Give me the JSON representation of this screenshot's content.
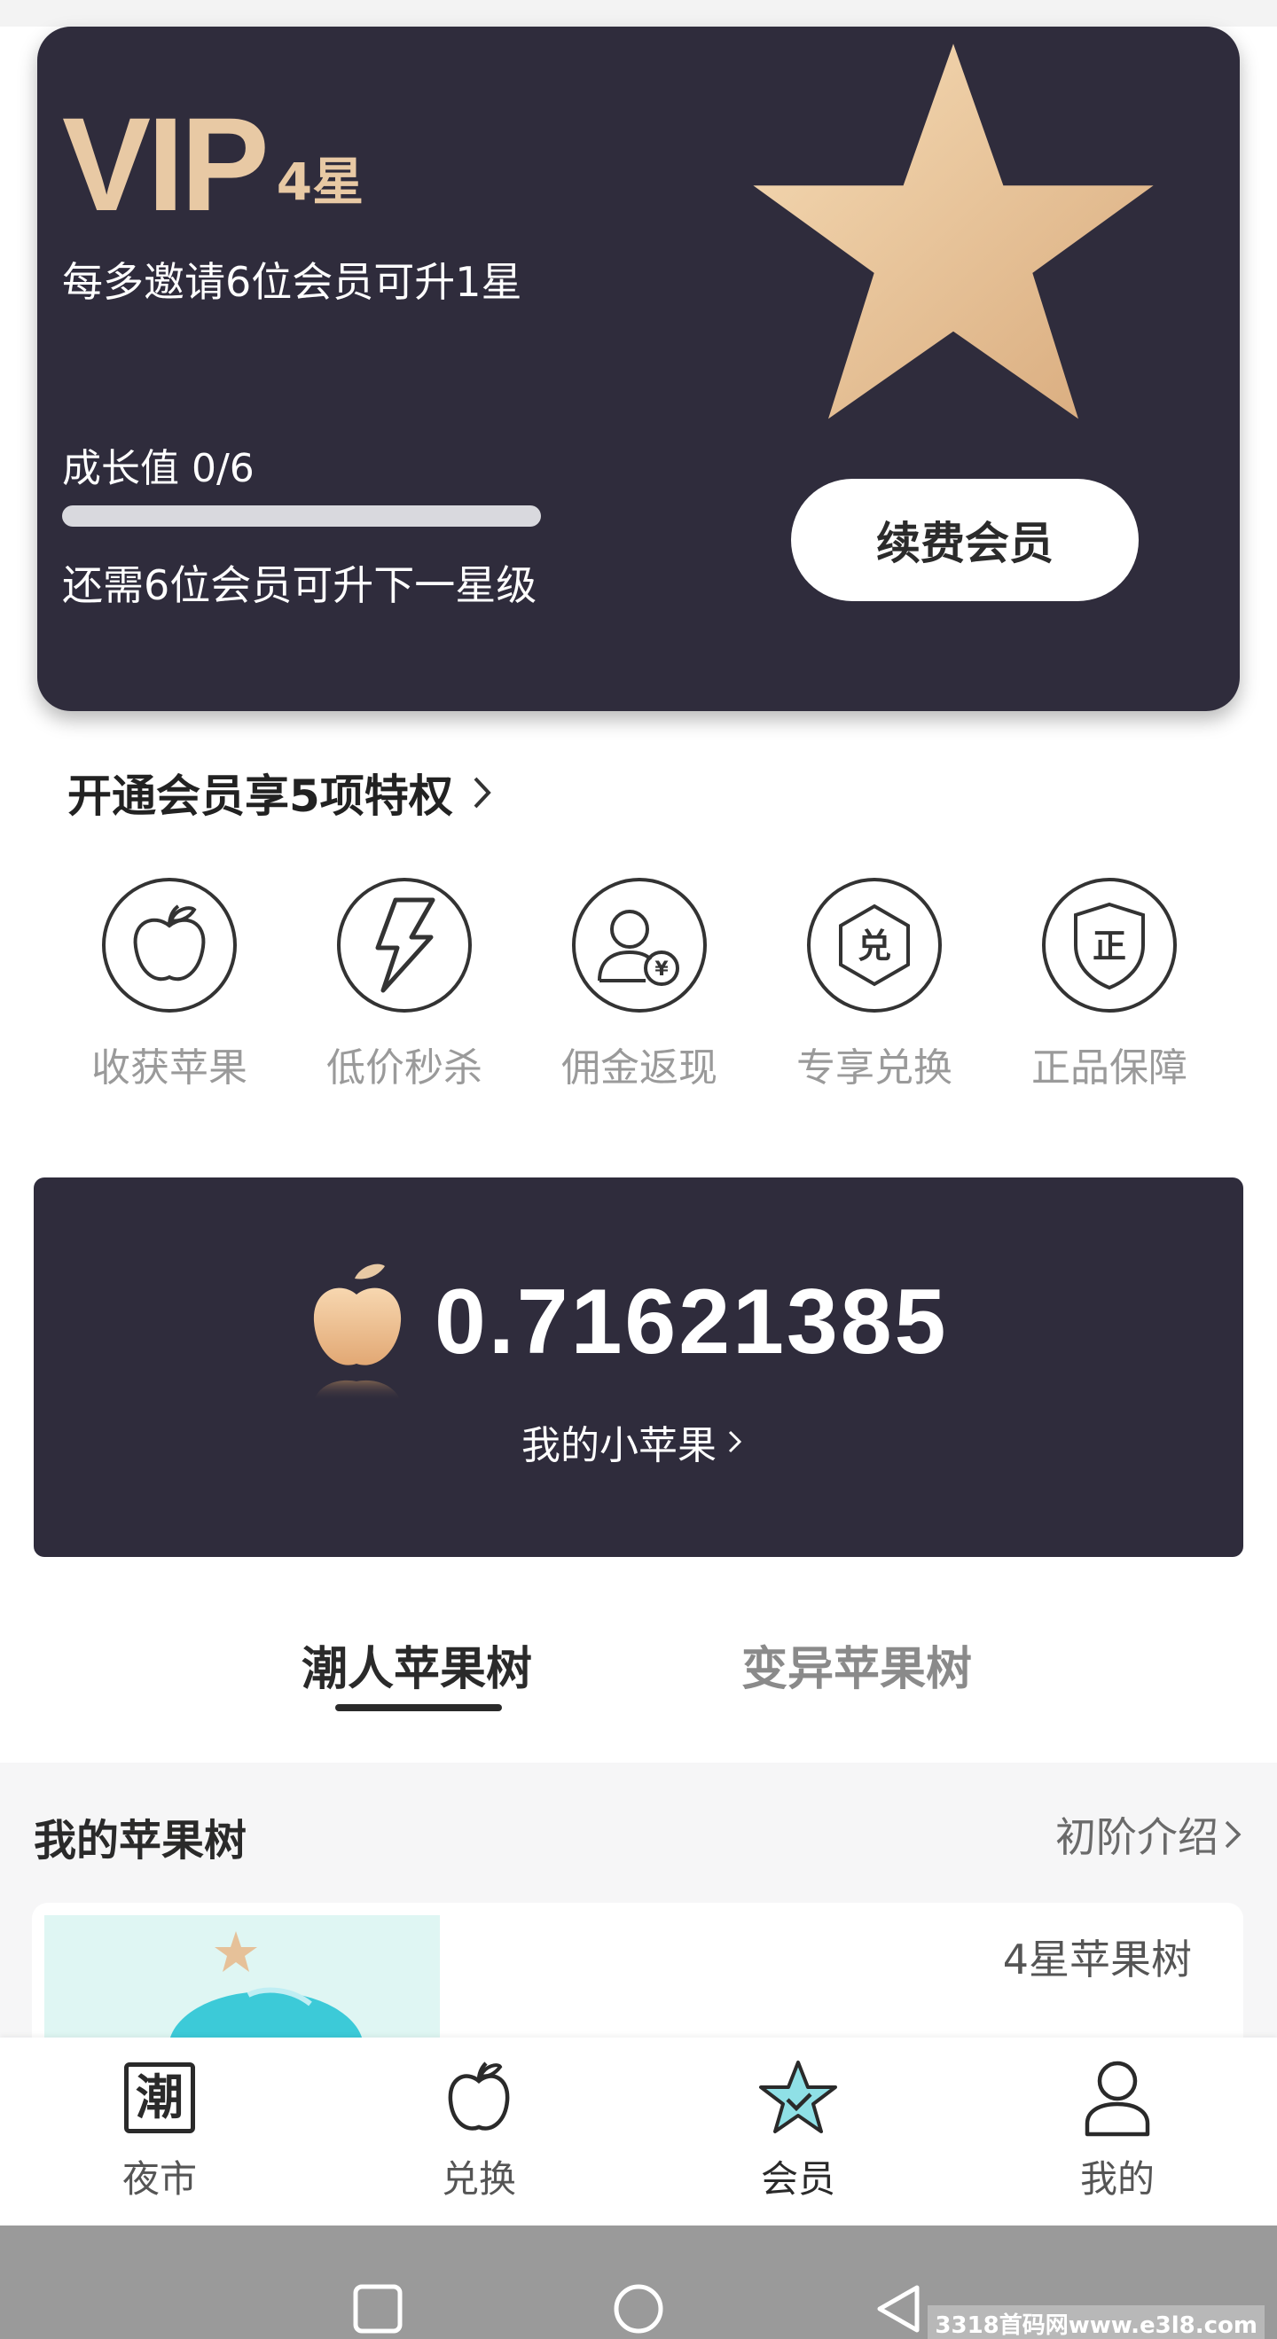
{
  "vip_card": {
    "vip_text": "VIP",
    "star_level": "4星",
    "subtitle": "每多邀请6位会员可升1星",
    "growth_label": "成长值 0/6",
    "progress": 0,
    "growth_hint": "还需6位会员可升下一星级",
    "renew_button": "续费会员",
    "accent_color": "#e8c9a4",
    "card_color": "#2f2c3c"
  },
  "privileges": {
    "title": "开通会员享5项特权",
    "items": [
      {
        "label": "收获苹果",
        "icon": "apple-icon"
      },
      {
        "label": "低价秒杀",
        "icon": "lightning-icon"
      },
      {
        "label": "佣金返现",
        "icon": "user-cashback-icon"
      },
      {
        "label": "专享兑换",
        "icon": "exchange-hexagon-icon"
      },
      {
        "label": "正品保障",
        "icon": "shield-genuine-icon"
      }
    ],
    "icon_glyphs": {
      "exchange": "兑",
      "genuine": "正",
      "currency": "¥"
    }
  },
  "apple_balance": {
    "amount": "0.71621385",
    "link_label": "我的小苹果"
  },
  "tree_tabs": {
    "tabs": [
      {
        "label": "潮人苹果树",
        "active": true
      },
      {
        "label": "变异苹果树",
        "active": false
      }
    ]
  },
  "my_tree": {
    "title": "我的苹果树",
    "intro_link": "初阶介绍",
    "level_label": "4星苹果树"
  },
  "bottom_nav": {
    "items": [
      {
        "label": "夜市",
        "icon": "chao-icon",
        "glyph": "潮",
        "active": false
      },
      {
        "label": "兑换",
        "icon": "apple-outline-icon",
        "active": false
      },
      {
        "label": "会员",
        "icon": "star-badge-icon",
        "active": true
      },
      {
        "label": "我的",
        "icon": "person-icon",
        "active": false
      }
    ]
  },
  "system_bar": {
    "watermark": "3318首码网www.e3l8.com"
  }
}
